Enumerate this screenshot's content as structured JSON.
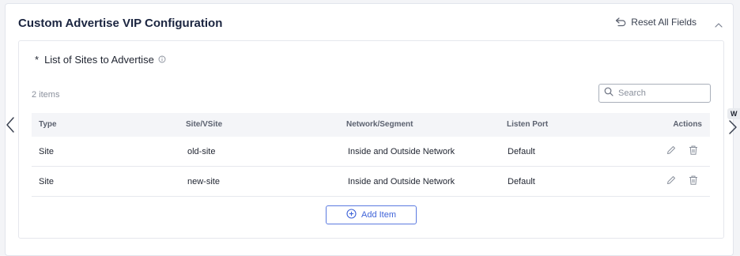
{
  "card": {
    "title": "Custom Advertise VIP Configuration",
    "reset_label": "Reset All Fields"
  },
  "section": {
    "required_marker": "*",
    "label": "List of Sites to Advertise"
  },
  "table": {
    "item_count": "2 items",
    "search_placeholder": "Search",
    "columns": [
      "Type",
      "Site/VSite",
      "Network/Segment",
      "Listen Port",
      "Actions"
    ],
    "rows": [
      {
        "type": "Site",
        "site": "old-site",
        "network": "Inside and Outside Network",
        "port": "Default"
      },
      {
        "type": "Site",
        "site": "new-site",
        "network": "Inside and Outside Network",
        "port": "Default"
      }
    ],
    "add_label": "Add Item"
  },
  "side_badge": "W",
  "colors": {
    "accent": "#3f63d8",
    "title": "#1b2540",
    "header_bg": "#f4f5f8"
  }
}
